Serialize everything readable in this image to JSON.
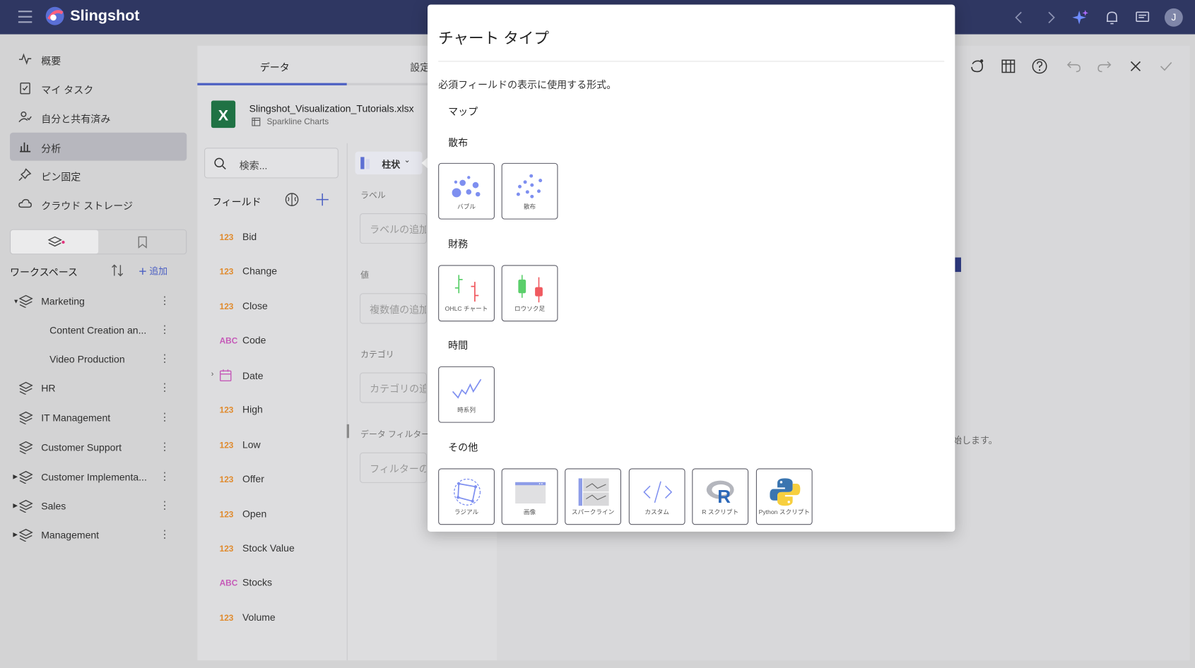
{
  "app": {
    "brand": "Slingshot",
    "avatar_initial": "J"
  },
  "sidebar": {
    "nav": [
      {
        "label": "概要",
        "icon": "activity-icon"
      },
      {
        "label": "マイ タスク",
        "icon": "clipboard-check-icon"
      },
      {
        "label": "自分と共有済み",
        "icon": "user-share-icon"
      },
      {
        "label": "分析",
        "icon": "bar-chart-icon"
      },
      {
        "label": "ピン固定",
        "icon": "pin-icon"
      },
      {
        "label": "クラウド ストレージ",
        "icon": "cloud-icon"
      }
    ],
    "workspace_header": "ワークスペース",
    "add_label": "追加",
    "workspaces": [
      {
        "label": "Marketing"
      },
      {
        "label": "Content Creation an..."
      },
      {
        "label": "Video Production"
      },
      {
        "label": "HR"
      },
      {
        "label": "IT Management"
      },
      {
        "label": "Customer Support"
      },
      {
        "label": "Customer Implementa..."
      },
      {
        "label": "Sales"
      },
      {
        "label": "Management"
      }
    ]
  },
  "editor": {
    "tabs": [
      {
        "label": "データ"
      },
      {
        "label": "設定"
      }
    ],
    "file_name": "Slingshot_Visualization_Tutorials.xlsx",
    "sheet_name": "Sparkline Charts",
    "search_placeholder": "検索...",
    "fields_header": "フィールド",
    "fields": [
      {
        "type": "123",
        "name": "Bid"
      },
      {
        "type": "123",
        "name": "Change"
      },
      {
        "type": "123",
        "name": "Close"
      },
      {
        "type": "ABC",
        "name": "Code"
      },
      {
        "type": "date",
        "name": "Date"
      },
      {
        "type": "123",
        "name": "High"
      },
      {
        "type": "123",
        "name": "Low"
      },
      {
        "type": "123",
        "name": "Offer"
      },
      {
        "type": "123",
        "name": "Open"
      },
      {
        "type": "123",
        "name": "Stock Value"
      },
      {
        "type": "ABC",
        "name": "Stocks"
      },
      {
        "type": "123",
        "name": "Volume"
      }
    ],
    "chart_type_button": "柱状",
    "sections": {
      "label_title": "ラベル",
      "label_placeholder": "ラベルの追加",
      "value_title": "値",
      "value_placeholder": "複数値の追加",
      "category_title": "カテゴリ",
      "category_placeholder": "カテゴリの追加",
      "filter_title": "データ フィルター",
      "filter_placeholder": "フィルターの追加"
    },
    "hint_text": "始します。"
  },
  "modal": {
    "title": "チャート タイプ",
    "description": "必須フィールドの表示に使用する形式。",
    "categories": [
      {
        "label": "マップ",
        "items": []
      },
      {
        "label": "散布",
        "items": [
          {
            "label": "バブル",
            "icon": "bubble-chart-icon"
          },
          {
            "label": "散布",
            "icon": "scatter-chart-icon"
          }
        ]
      },
      {
        "label": "財務",
        "items": [
          {
            "label": "OHLC チャート",
            "icon": "ohlc-chart-icon"
          },
          {
            "label": "ロウソク足",
            "icon": "candlestick-chart-icon"
          }
        ]
      },
      {
        "label": "時間",
        "items": [
          {
            "label": "時系列",
            "icon": "time-series-chart-icon"
          }
        ]
      },
      {
        "label": "その他",
        "items": [
          {
            "label": "ラジアル",
            "icon": "radial-chart-icon"
          },
          {
            "label": "画像",
            "icon": "image-icon"
          },
          {
            "label": "スパークライン",
            "icon": "sparkline-icon"
          },
          {
            "label": "カスタム",
            "icon": "code-icon"
          },
          {
            "label": "R スクリプト",
            "icon": "r-script-icon"
          },
          {
            "label": "Python スクリプト",
            "icon": "python-script-icon"
          }
        ]
      }
    ]
  },
  "colors": {
    "topbar": "#2f3762",
    "accent": "#4b5fc2",
    "chart_icon": "#7e8ff0"
  }
}
